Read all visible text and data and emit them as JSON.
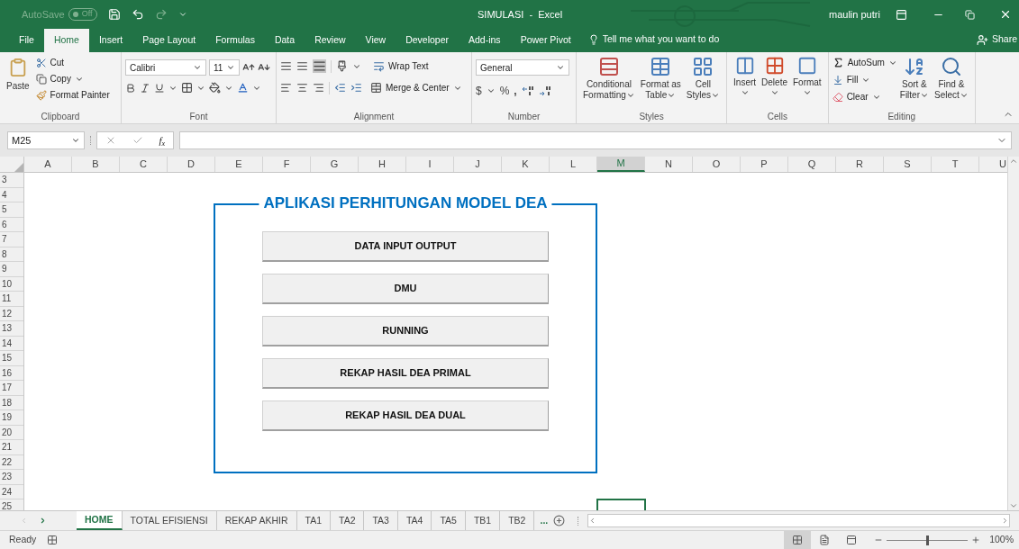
{
  "title_bar": {
    "autosave_label": "AutoSave",
    "autosave": {
      "on": false,
      "label": "Off"
    },
    "title": "SIMULASI  -  Excel",
    "user": "maulin putri"
  },
  "menu_tabs": [
    {
      "label": "File",
      "selected": false
    },
    {
      "label": "Home",
      "selected": true
    },
    {
      "label": "Insert",
      "selected": false
    },
    {
      "label": "Page Layout",
      "selected": false
    },
    {
      "label": "Formulas",
      "selected": false
    },
    {
      "label": "Data",
      "selected": false
    },
    {
      "label": "Review",
      "selected": false
    },
    {
      "label": "View",
      "selected": false
    },
    {
      "label": "Developer",
      "selected": false
    },
    {
      "label": "Add-ins",
      "selected": false
    },
    {
      "label": "Power Pivot",
      "selected": false
    }
  ],
  "tell_me": "Tell me what you want to do",
  "share": "Share",
  "ribbon": {
    "clipboard": {
      "paste": "Paste",
      "cut": "Cut",
      "copy": "Copy",
      "format_painter": "Format Painter",
      "label": "Clipboard"
    },
    "font": {
      "name": "Calibri",
      "size": "11",
      "label": "Font"
    },
    "alignment": {
      "wrap": "Wrap Text",
      "merge": "Merge & Center",
      "label": "Alignment"
    },
    "number": {
      "format": "General",
      "currency": "$",
      "percent": "%",
      "comma": ",",
      "label": "Number"
    },
    "styles": {
      "buttons": [
        [
          "Conditional",
          "Formatting"
        ],
        [
          "Format as",
          "Table"
        ],
        [
          "Cell",
          "Styles"
        ]
      ],
      "label": "Styles"
    },
    "cells": {
      "buttons": [
        "Insert",
        "Delete",
        "Format"
      ],
      "label": "Cells"
    },
    "editing": {
      "autosum": "AutoSum",
      "fill": "Fill",
      "clear": "Clear",
      "sort": [
        "Sort &",
        "Filter"
      ],
      "find": [
        "Find &",
        "Select"
      ],
      "label": "Editing"
    }
  },
  "formula_bar": {
    "name_box": "M25",
    "fx": "f$_{x}$"
  },
  "columns": [
    {
      "label": "A",
      "selected": false
    },
    {
      "label": "B",
      "selected": false
    },
    {
      "label": "C",
      "selected": false
    },
    {
      "label": "D",
      "selected": false
    },
    {
      "label": "E",
      "selected": false
    },
    {
      "label": "F",
      "selected": false
    },
    {
      "label": "G",
      "selected": false
    },
    {
      "label": "H",
      "selected": false
    },
    {
      "label": "I",
      "selected": false
    },
    {
      "label": "J",
      "selected": false
    },
    {
      "label": "K",
      "selected": false
    },
    {
      "label": "L",
      "selected": false
    },
    {
      "label": "M",
      "selected": true
    },
    {
      "label": "N",
      "selected": false
    },
    {
      "label": "O",
      "selected": false
    },
    {
      "label": "P",
      "selected": false
    },
    {
      "label": "Q",
      "selected": false
    },
    {
      "label": "R",
      "selected": false
    },
    {
      "label": "S",
      "selected": false
    },
    {
      "label": "T",
      "selected": false
    },
    {
      "label": "U",
      "selected": false
    }
  ],
  "rows": [
    "3",
    "4",
    "5",
    "6",
    "7",
    "8",
    "9",
    "10",
    "11",
    "12",
    "13",
    "14",
    "15",
    "16",
    "17",
    "18",
    "19",
    "20",
    "21",
    "22",
    "23",
    "24",
    "25"
  ],
  "panel": {
    "title": "APLIKASI PERHITUNGAN MODEL DEA",
    "buttons": [
      "DATA INPUT OUTPUT",
      "DMU",
      "RUNNING",
      "REKAP HASIL DEA PRIMAL",
      "REKAP HASIL DEA DUAL"
    ]
  },
  "sheet_tabs": [
    {
      "label": "HOME",
      "selected": true
    },
    {
      "label": "TOTAL EFISIENSI",
      "selected": false
    },
    {
      "label": "REKAP AKHIR",
      "selected": false
    },
    {
      "label": "TA1",
      "selected": false
    },
    {
      "label": "TA2",
      "selected": false
    },
    {
      "label": "TA3",
      "selected": false
    },
    {
      "label": "TA4",
      "selected": false
    },
    {
      "label": "TA5",
      "selected": false
    },
    {
      "label": "TB1",
      "selected": false
    },
    {
      "label": "TB2",
      "selected": false
    }
  ],
  "more_tabs": "...",
  "status_bar": {
    "ready": "Ready",
    "views": [
      {
        "kind": "normal",
        "selected": true
      },
      {
        "kind": "page_layout",
        "selected": false
      },
      {
        "kind": "page_break",
        "selected": false
      }
    ],
    "zoom": {
      "level": 0.5,
      "reading": "100%"
    }
  }
}
